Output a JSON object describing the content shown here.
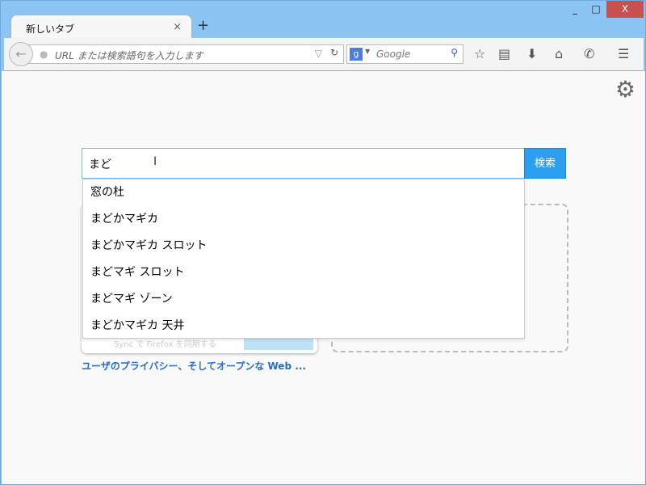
{
  "window": {
    "minimize": "_",
    "maximize": "□",
    "close": "X"
  },
  "tab": {
    "title": "新しいタブ",
    "close": "×",
    "new": "+"
  },
  "toolbar": {
    "url_placeholder": "URL または検索語句を入力します",
    "search_placeholder": "Google",
    "search_engine": "g"
  },
  "main": {
    "query": "まど",
    "search_button": "検索",
    "suggestions": [
      "窓の杜",
      "まどかマギカ",
      "まどかマギカ スロット",
      "まどマギ スロット",
      "まどマギ ゾーン",
      "まどかマギカ 天井"
    ],
    "tile_sync_text": "Sync で Firefox を同期する",
    "link": "ユーザのプライバシー、そしてオープンな Web ..."
  },
  "colors": {
    "frame": "#8cc4f4",
    "accent": "#2c9ff0",
    "close": "#c75050"
  }
}
